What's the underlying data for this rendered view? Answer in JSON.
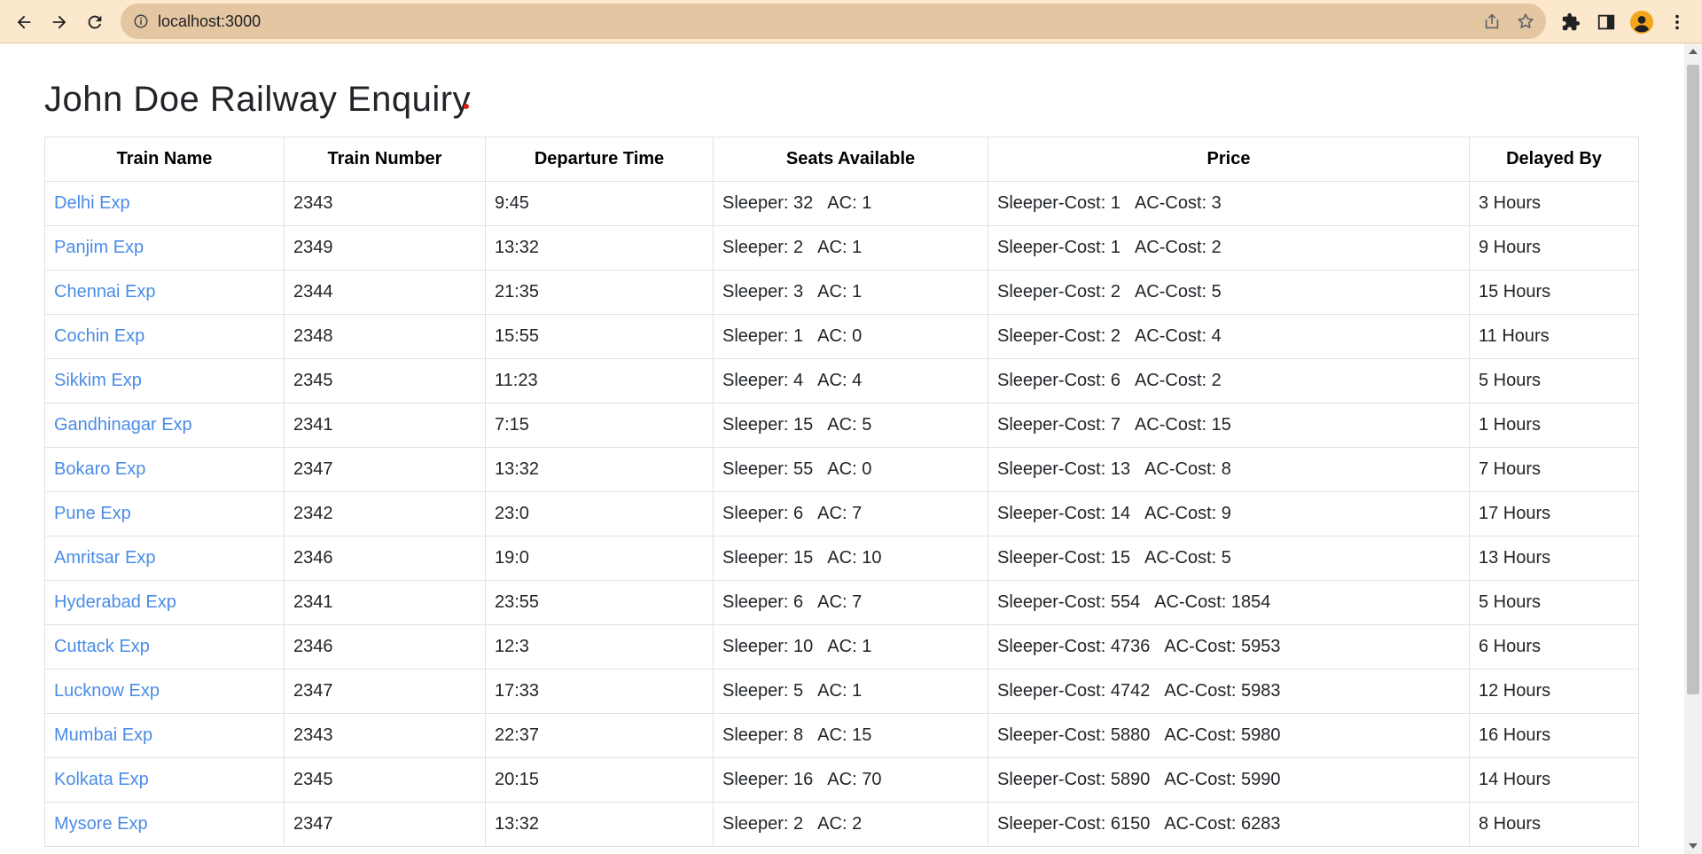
{
  "browser": {
    "url": "localhost:3000",
    "theme_color": "#fce8cc"
  },
  "page": {
    "title": "John Doe Railway Enquiry",
    "link_color": "#4a8ce6",
    "accent_dot_color": "#e31b1b"
  },
  "table": {
    "headers": {
      "name": "Train Name",
      "number": "Train Number",
      "departure": "Departure Time",
      "seats": "Seats Available",
      "price": "Price",
      "delay": "Delayed By"
    },
    "rows": [
      {
        "name": "Delhi Exp",
        "number": "2343",
        "departure": "9:45",
        "sleeper": "Sleeper: 32",
        "ac": "AC: 1",
        "sleeper_cost": "Sleeper-Cost: 1",
        "ac_cost": "AC-Cost: 3",
        "delay": "3 Hours"
      },
      {
        "name": "Panjim Exp",
        "number": "2349",
        "departure": "13:32",
        "sleeper": "Sleeper: 2",
        "ac": "AC: 1",
        "sleeper_cost": "Sleeper-Cost: 1",
        "ac_cost": "AC-Cost: 2",
        "delay": "9 Hours"
      },
      {
        "name": "Chennai Exp",
        "number": "2344",
        "departure": "21:35",
        "sleeper": "Sleeper: 3",
        "ac": "AC: 1",
        "sleeper_cost": "Sleeper-Cost: 2",
        "ac_cost": "AC-Cost: 5",
        "delay": "15 Hours"
      },
      {
        "name": "Cochin Exp",
        "number": "2348",
        "departure": "15:55",
        "sleeper": "Sleeper: 1",
        "ac": "AC: 0",
        "sleeper_cost": "Sleeper-Cost: 2",
        "ac_cost": "AC-Cost: 4",
        "delay": "11 Hours"
      },
      {
        "name": "Sikkim Exp",
        "number": "2345",
        "departure": "11:23",
        "sleeper": "Sleeper: 4",
        "ac": "AC: 4",
        "sleeper_cost": "Sleeper-Cost: 6",
        "ac_cost": "AC-Cost: 2",
        "delay": "5 Hours"
      },
      {
        "name": "Gandhinagar Exp",
        "number": "2341",
        "departure": "7:15",
        "sleeper": "Sleeper: 15",
        "ac": "AC: 5",
        "sleeper_cost": "Sleeper-Cost: 7",
        "ac_cost": "AC-Cost: 15",
        "delay": "1 Hours"
      },
      {
        "name": "Bokaro Exp",
        "number": "2347",
        "departure": "13:32",
        "sleeper": "Sleeper: 55",
        "ac": "AC: 0",
        "sleeper_cost": "Sleeper-Cost: 13",
        "ac_cost": "AC-Cost: 8",
        "delay": "7 Hours"
      },
      {
        "name": "Pune Exp",
        "number": "2342",
        "departure": "23:0",
        "sleeper": "Sleeper: 6",
        "ac": "AC: 7",
        "sleeper_cost": "Sleeper-Cost: 14",
        "ac_cost": "AC-Cost: 9",
        "delay": "17 Hours"
      },
      {
        "name": "Amritsar Exp",
        "number": "2346",
        "departure": "19:0",
        "sleeper": "Sleeper: 15",
        "ac": "AC: 10",
        "sleeper_cost": "Sleeper-Cost: 15",
        "ac_cost": "AC-Cost: 5",
        "delay": "13 Hours"
      },
      {
        "name": "Hyderabad Exp",
        "number": "2341",
        "departure": "23:55",
        "sleeper": "Sleeper: 6",
        "ac": "AC: 7",
        "sleeper_cost": "Sleeper-Cost: 554",
        "ac_cost": "AC-Cost: 1854",
        "delay": "5 Hours"
      },
      {
        "name": "Cuttack Exp",
        "number": "2346",
        "departure": "12:3",
        "sleeper": "Sleeper: 10",
        "ac": "AC: 1",
        "sleeper_cost": "Sleeper-Cost: 4736",
        "ac_cost": "AC-Cost: 5953",
        "delay": "6 Hours"
      },
      {
        "name": "Lucknow Exp",
        "number": "2347",
        "departure": "17:33",
        "sleeper": "Sleeper: 5",
        "ac": "AC: 1",
        "sleeper_cost": "Sleeper-Cost: 4742",
        "ac_cost": "AC-Cost: 5983",
        "delay": "12 Hours"
      },
      {
        "name": "Mumbai Exp",
        "number": "2343",
        "departure": "22:37",
        "sleeper": "Sleeper: 8",
        "ac": "AC: 15",
        "sleeper_cost": "Sleeper-Cost: 5880",
        "ac_cost": "AC-Cost: 5980",
        "delay": "16 Hours"
      },
      {
        "name": "Kolkata Exp",
        "number": "2345",
        "departure": "20:15",
        "sleeper": "Sleeper: 16",
        "ac": "AC: 70",
        "sleeper_cost": "Sleeper-Cost: 5890",
        "ac_cost": "AC-Cost: 5990",
        "delay": "14 Hours"
      },
      {
        "name": "Mysore Exp",
        "number": "2347",
        "departure": "13:32",
        "sleeper": "Sleeper: 2",
        "ac": "AC: 2",
        "sleeper_cost": "Sleeper-Cost: 6150",
        "ac_cost": "AC-Cost: 6283",
        "delay": "8 Hours"
      }
    ]
  }
}
